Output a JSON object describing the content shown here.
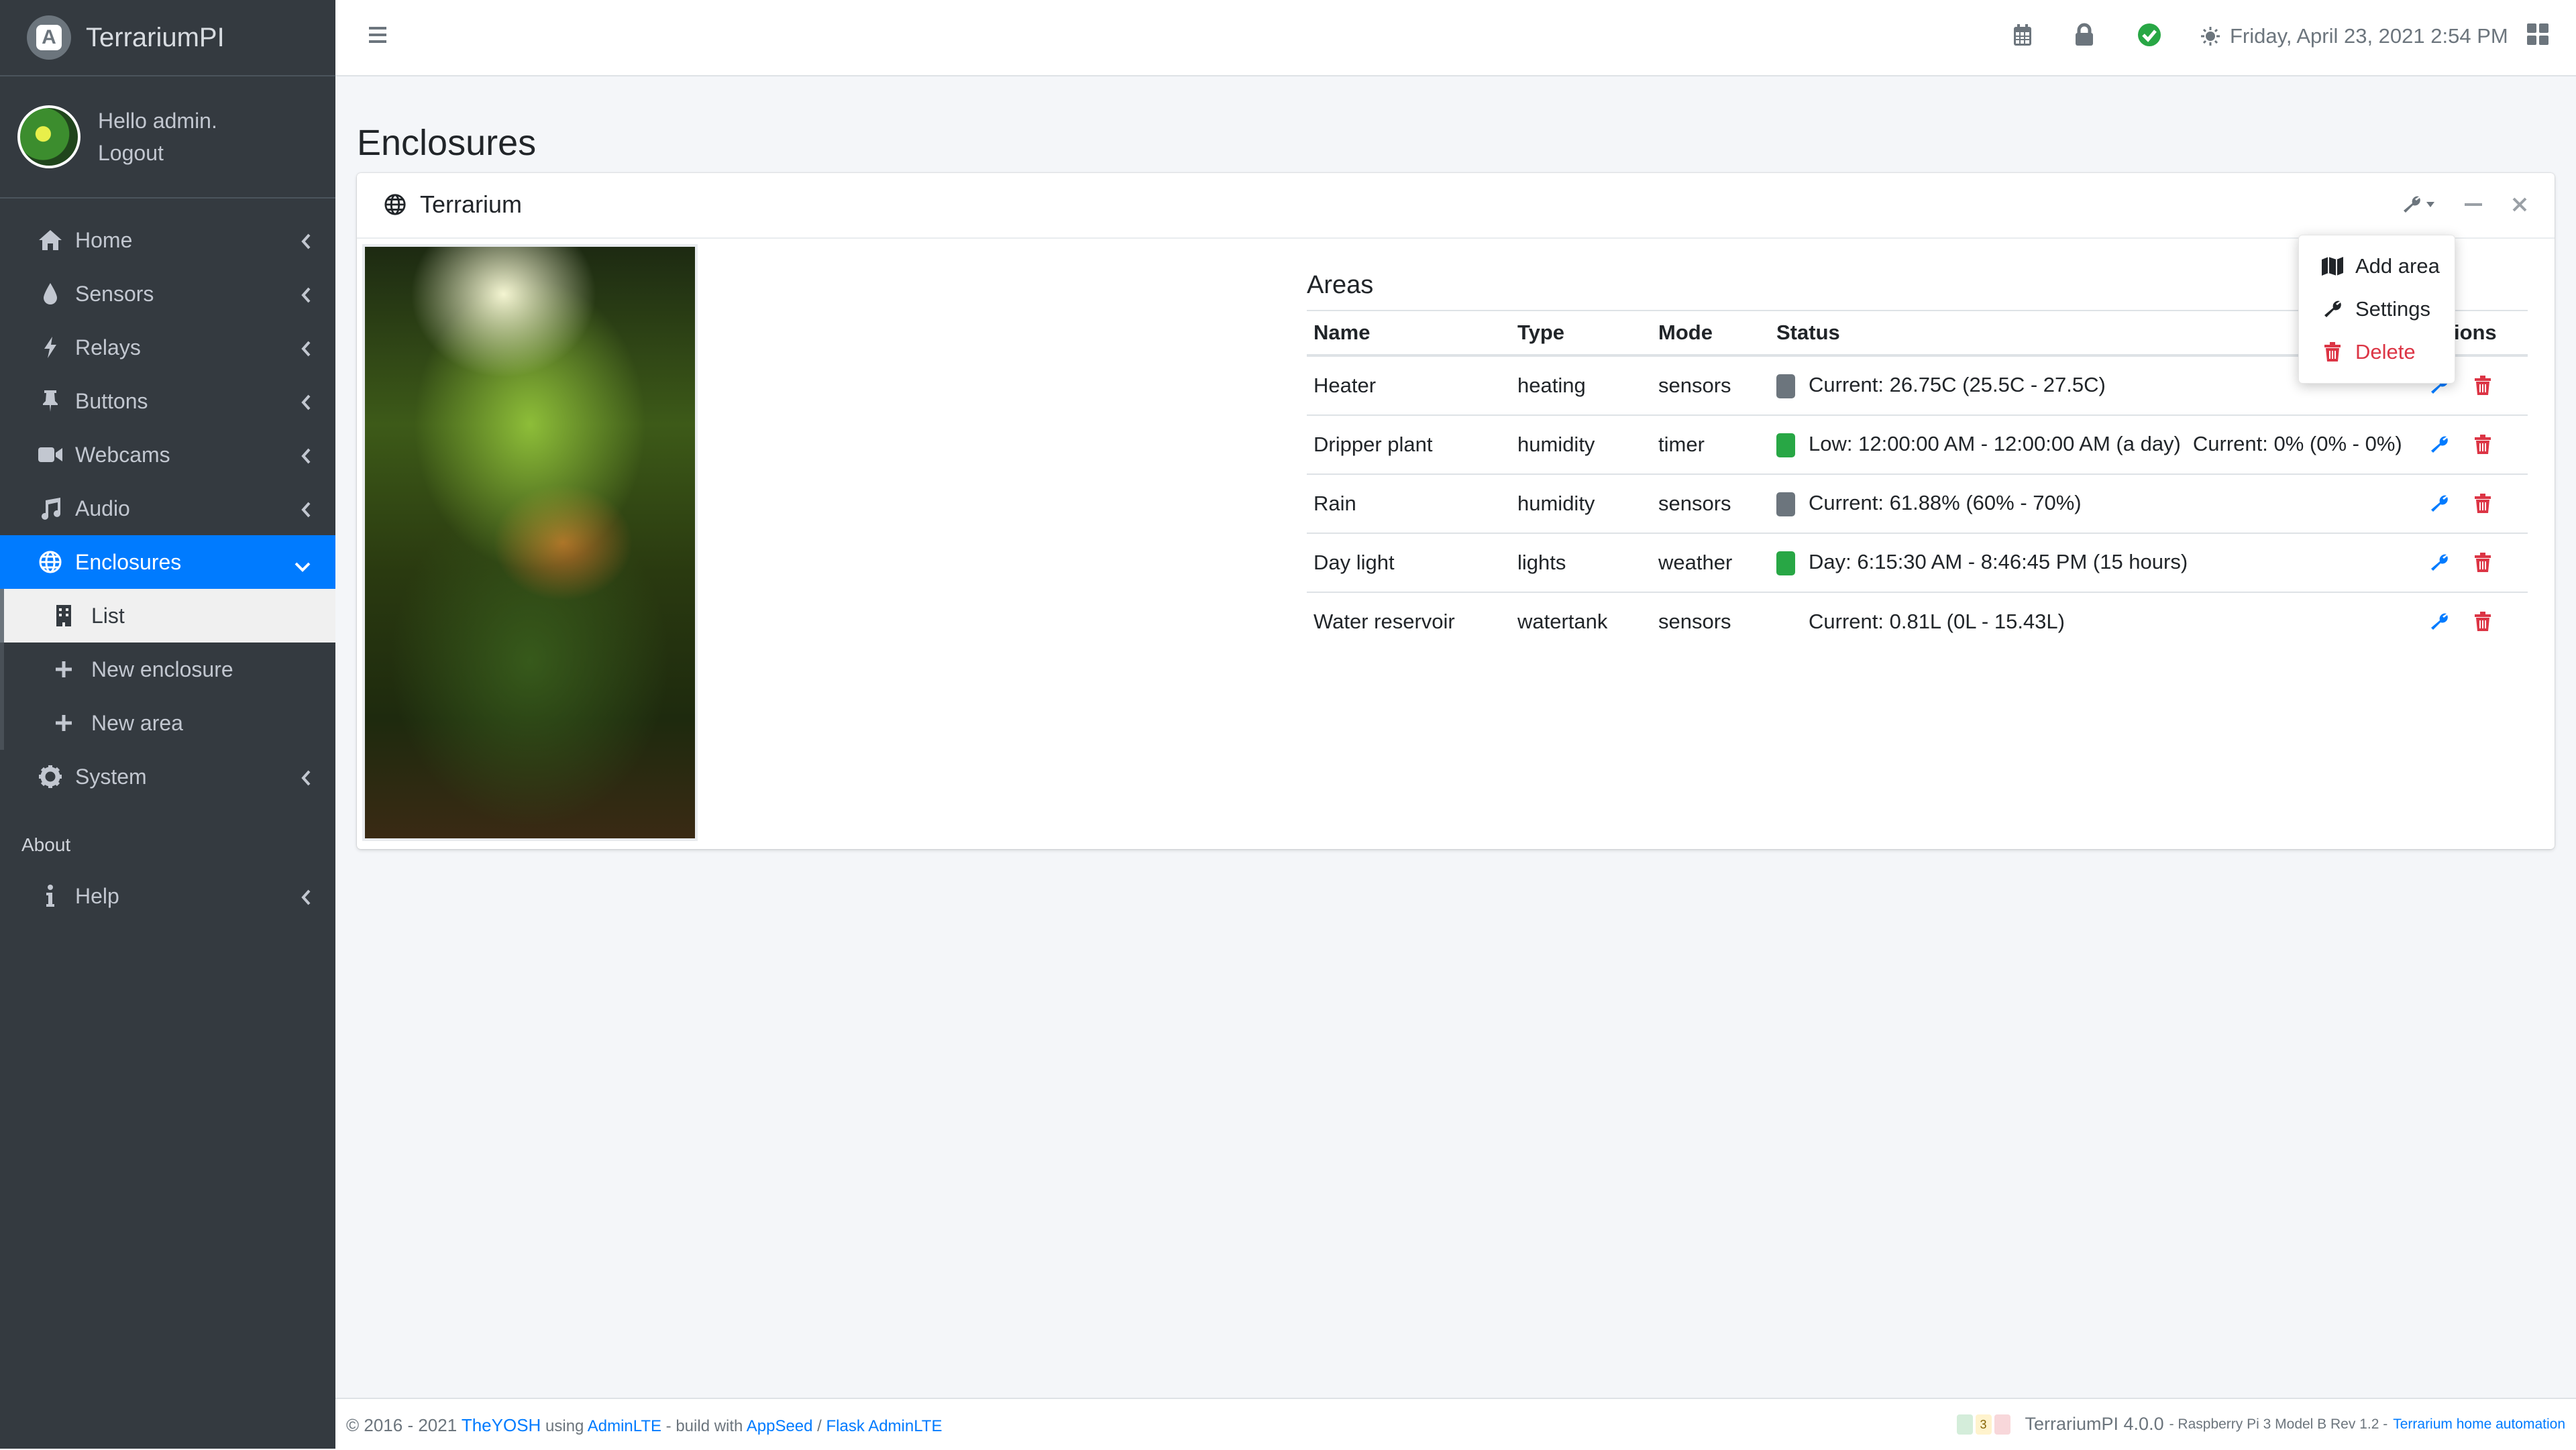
{
  "brand": {
    "name": "TerrariumPI",
    "logo_icon": "terrarium-logo-icon"
  },
  "user": {
    "greeting": "Hello admin.",
    "logout": "Logout"
  },
  "sidebar": {
    "items": [
      {
        "label": "Home",
        "icon": "home-icon"
      },
      {
        "label": "Sensors",
        "icon": "tint-icon"
      },
      {
        "label": "Relays",
        "icon": "bolt-icon"
      },
      {
        "label": "Buttons",
        "icon": "thumbtack-icon"
      },
      {
        "label": "Webcams",
        "icon": "video-icon"
      },
      {
        "label": "Audio",
        "icon": "music-icon"
      },
      {
        "label": "Enclosures",
        "icon": "globe-icon"
      },
      {
        "label": "System",
        "icon": "gear-icon"
      }
    ],
    "enclosures_sub": [
      {
        "label": "List",
        "icon": "building-icon"
      },
      {
        "label": "New enclosure",
        "icon": "plus-icon"
      },
      {
        "label": "New area",
        "icon": "plus-icon"
      }
    ],
    "about_header": "About",
    "help": {
      "label": "Help",
      "icon": "info-icon"
    }
  },
  "topbar": {
    "datetime": "Friday, April 23, 2021 2:54 PM",
    "status_color": "#28a745"
  },
  "page": {
    "title": "Enclosures"
  },
  "card": {
    "title": "Terrarium",
    "areas_title": "Areas",
    "columns": [
      "Name",
      "Type",
      "Mode",
      "Status",
      "Actions"
    ],
    "rows": [
      {
        "name": "Heater",
        "type": "heating",
        "mode": "sensors",
        "status_color": "#6c757d",
        "status": "Current: 26.75C (25.5C - 27.5C)",
        "extra": ""
      },
      {
        "name": "Dripper plant",
        "type": "humidity",
        "mode": "timer",
        "status_color": "#28a745",
        "status": "Low: 12:00:00 AM - 12:00:00 AM (a day)",
        "extra": "Current: 0% (0% - 0%)"
      },
      {
        "name": "Rain",
        "type": "humidity",
        "mode": "sensors",
        "status_color": "#6c757d",
        "status": "Current: 61.88% (60% - 70%)",
        "extra": ""
      },
      {
        "name": "Day light",
        "type": "lights",
        "mode": "weather",
        "status_color": "#28a745",
        "status": "Day: 6:15:30 AM - 8:46:45 PM (15 hours)",
        "extra": ""
      },
      {
        "name": "Water reservoir",
        "type": "watertank",
        "mode": "sensors",
        "status_color": "",
        "status": "Current: 0.81L (0L - 15.43L)",
        "extra": ""
      }
    ]
  },
  "dropdown": {
    "items": [
      {
        "label": "Add area",
        "icon": "map-icon"
      },
      {
        "label": "Settings",
        "icon": "wrench-icon"
      },
      {
        "label": "Delete",
        "icon": "trash-icon"
      }
    ]
  },
  "footer": {
    "copyright": "© 2016 - 2021",
    "author": "TheYOSH",
    "using": "using",
    "adminlte": "AdminLTE",
    "build_with": "- build with",
    "appseed": "AppSeed",
    "slash": "/",
    "flask": "Flask AdminLTE",
    "badge_count": "3",
    "version": "TerrariumPI 4.0.0",
    "device": "- Raspberry Pi 3 Model B Rev 1.2 -",
    "tagline": "Terrarium home automation"
  },
  "colors": {
    "accent": "#007bff",
    "danger": "#dc3545",
    "sidebar_bg": "#343a40"
  }
}
